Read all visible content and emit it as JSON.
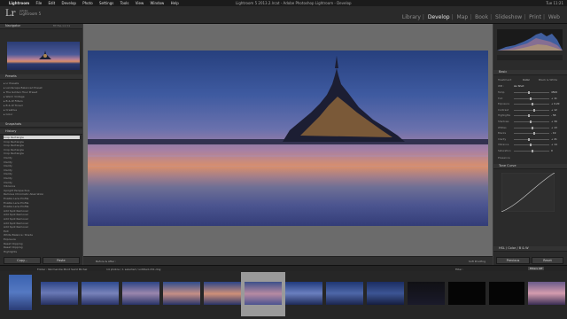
{
  "menubar": {
    "items": [
      "Lightroom",
      "File",
      "Edit",
      "Develop",
      "Photo",
      "Settings",
      "Tools",
      "View",
      "Window",
      "Help"
    ],
    "window_title": "Lightroom 5 2013.2.lrcat - Adobe Photoshop Lightroom - Develop",
    "right_status": "Tue 11:21"
  },
  "identity": {
    "logo": "Lr",
    "product_line1": "Adobe",
    "product_line2": "Lightroom 5"
  },
  "modules": {
    "items": [
      "Library",
      "Develop",
      "Map",
      "Book",
      "Slideshow",
      "Print",
      "Web"
    ],
    "active": "Develop"
  },
  "left_panel": {
    "navigator_label": "Navigator",
    "navigator_zoom": "FIT FILL 1:1 3:1",
    "presets": [
      "Lr Presets",
      "Landscape Balanced Preset",
      "The Golden Hour Preset",
      "Warm Vintage",
      "B & W Filters",
      "B & W Toned",
      "Creative",
      "Color"
    ],
    "snapshots_label": "Snapshots",
    "history_label": "History",
    "history_items": [
      "Crop Rectangle",
      "Crop Rectangle",
      "Crop Rectangle",
      "Crop Rectangle",
      "Crop Rectangle",
      "Clarity",
      "Clarity",
      "Clarity",
      "Clarity",
      "Clarity",
      "Clarity",
      "Clarity",
      "Vibrance",
      "Upright Perspective",
      "Remove Chromatic Aberration",
      "Enable Lens Profile",
      "Enable Lens Profile",
      "Enable Lens Profile",
      "Add Spot Removal",
      "Add Spot Removal",
      "Add Spot Removal",
      "Add Spot Removal",
      "Add Spot Removal",
      "Exit",
      "White Balance: Shade",
      "Exposure",
      "Reset Clipping",
      "Reset Clipping",
      "Highlights"
    ],
    "copy_button": "Copy...",
    "paste_button": "Paste"
  },
  "toolbar": {
    "before_after": "Before & After :",
    "softproof": "Soft Proofing"
  },
  "right_panel": {
    "basic_label": "Basic",
    "treatment_label": "Treatment",
    "color_label": "Color",
    "bw_label": "Black & White",
    "wb_label": "WB :",
    "wb_value": "As Shot",
    "tone_label": "Tone",
    "auto_label": "Auto",
    "presence_label": "Presence",
    "tone_curve_label": "Tone Curve",
    "hsl_label": "HSL / Color / B & W",
    "sliders": [
      {
        "name": "Temp",
        "value": "4500"
      },
      {
        "name": "Tint",
        "value": "+ 11"
      },
      {
        "name": "Exposure",
        "value": "+ 0.20"
      },
      {
        "name": "Contrast",
        "value": "+ 12"
      },
      {
        "name": "Highlights",
        "value": "- 58"
      },
      {
        "name": "Shadows",
        "value": "+ 39"
      },
      {
        "name": "Whites",
        "value": "+ 13"
      },
      {
        "name": "Blacks",
        "value": "- 19"
      },
      {
        "name": "Clarity",
        "value": "+ 21"
      },
      {
        "name": "Vibrance",
        "value": "+ 14"
      },
      {
        "name": "Saturation",
        "value": "0"
      }
    ],
    "previous_button": "Previous",
    "reset_button": "Reset"
  },
  "filmstrip": {
    "source_label": "Folder : Normandie Mont Saint Michel",
    "count": "14 photos / 1 selected / untitled-151.dng",
    "filter_label": "Filter :",
    "filter_value": "Filters Off"
  },
  "colors": {
    "panel_bg": "#2b2b2b",
    "workspace": "#6b6b6b",
    "active_module": "#e8e8e8"
  }
}
